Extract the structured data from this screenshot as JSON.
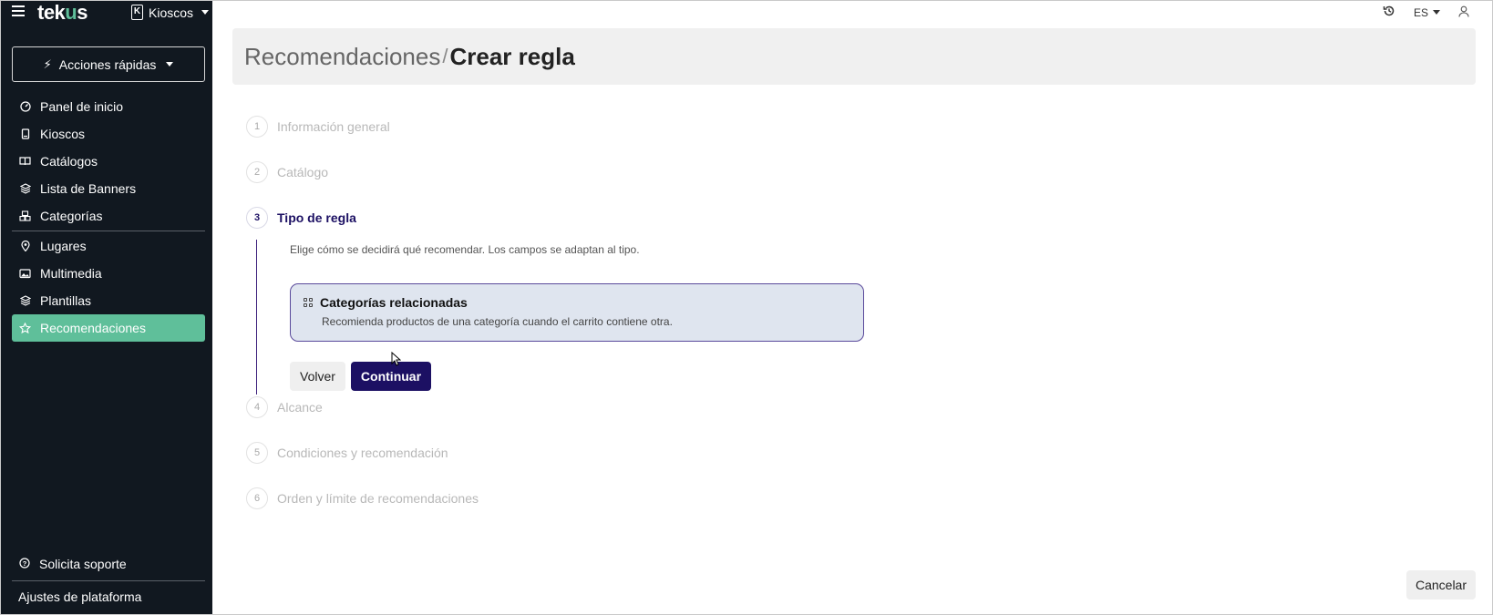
{
  "brand": {
    "logo_pre": "tek",
    "logo_accent": "u",
    "logo_post": "s",
    "kiosk_badge": "K",
    "kiosk_label": "Kioscos"
  },
  "quick_actions": {
    "label": "Acciones rápidas"
  },
  "sidebar": {
    "items": [
      {
        "label": "Panel de inicio",
        "icon": "dashboard-icon"
      },
      {
        "label": "Kioscos",
        "icon": "kiosk-icon"
      },
      {
        "label": "Catálogos",
        "icon": "book-icon"
      },
      {
        "label": "Lista de Banners",
        "icon": "layers-icon"
      },
      {
        "label": "Categorías",
        "icon": "boxes-icon"
      },
      {
        "label": "Lugares",
        "icon": "pin-icon"
      },
      {
        "label": "Multimedia",
        "icon": "image-icon"
      },
      {
        "label": "Plantillas",
        "icon": "stack-icon"
      },
      {
        "label": "Recomendaciones",
        "icon": "star-icon",
        "active": true
      }
    ],
    "support": "Solicita soporte",
    "platform_settings": "Ajustes de plataforma"
  },
  "topbar": {
    "language": "ES"
  },
  "header": {
    "breadcrumb_parent": "Recomendaciones",
    "separator": "/",
    "title": "Crear regla"
  },
  "steps": [
    {
      "num": "1",
      "title": "Información general"
    },
    {
      "num": "2",
      "title": "Catálogo"
    },
    {
      "num": "3",
      "title": "Tipo de regla",
      "active": true
    },
    {
      "num": "4",
      "title": "Alcance"
    },
    {
      "num": "5",
      "title": "Condiciones y recomendación"
    },
    {
      "num": "6",
      "title": "Orden y límite de recomendaciones"
    }
  ],
  "step3": {
    "description": "Elige cómo se decidirá qué recomendar. Los campos se adaptan al tipo.",
    "option_title": "Categorías relacionadas",
    "option_desc": "Recomienda productos de una categoría cuando el carrito contiene otra.",
    "back_label": "Volver",
    "continue_label": "Continuar"
  },
  "footer": {
    "cancel_label": "Cancelar"
  },
  "colors": {
    "sidebar_bg": "#111820",
    "accent_green": "#5fbf9a",
    "primary_navy": "#1c1063",
    "card_bg": "#dfe5ef"
  }
}
